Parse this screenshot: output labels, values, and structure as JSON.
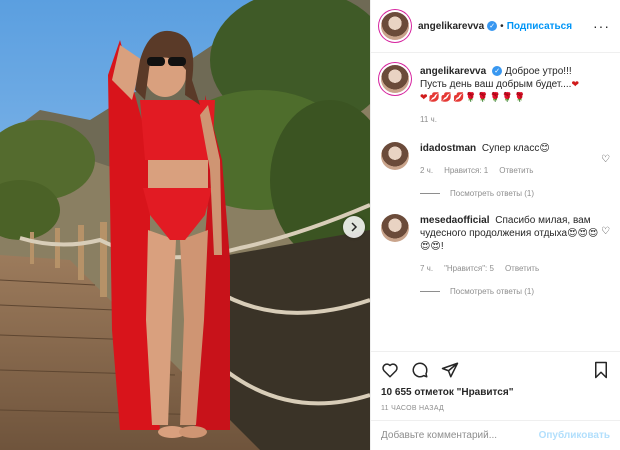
{
  "post": {
    "username": "angelikarevva",
    "follow_label": "Подписаться",
    "separator": "•",
    "more_label": "···",
    "verified_mark": "✓"
  },
  "caption": {
    "username": "angelikarevva",
    "text_line1": "Доброе утро!!!",
    "text_line2": "Пусть день ваш добрым будет....",
    "heart": "❤",
    "emojis": "❤💋💋💋🌹🌹🌹🌹🌹",
    "time": "11 ч."
  },
  "comments": [
    {
      "username": "idadostman",
      "text": "Супер класс😊",
      "time": "2 ч.",
      "likes_label": "Нравится: 1",
      "reply_label": "Ответить",
      "replies_label": "Посмотреть ответы (1)"
    },
    {
      "username": "mesedaofficial",
      "text": "Спасибо милая, вам чудесного продолжения отдыха😍😍😍😍😍!",
      "time": "7 ч.",
      "likes_label": "\"Нравится\": 5",
      "reply_label": "Ответить",
      "replies_label": "Посмотреть ответы (1)"
    }
  ],
  "stats": {
    "likes_label": "10 655 отметок \"Нравится\"",
    "timestamp": "11 ЧАСОВ НАЗАД"
  },
  "composer": {
    "placeholder": "Добавьте комментарий...",
    "publish_label": "Опубликовать"
  },
  "icons": [
    "heart-icon",
    "comment-icon",
    "share-icon",
    "bookmark-icon",
    "next-arrow-icon",
    "verified-icon"
  ],
  "colors": {
    "accent": "#0095f6",
    "verified": "#3897f0",
    "swimsuit": "#e21b23"
  }
}
